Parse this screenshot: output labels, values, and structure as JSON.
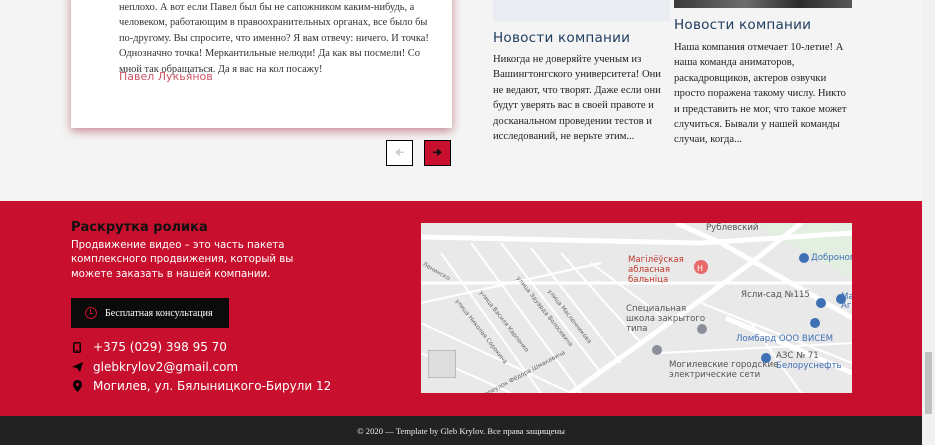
{
  "testimonial": {
    "text": "неплохо. А вот если Павел был бы не сапожником каким-нибудь, а человеком, работающим в правоохранительных органах, все было бы по-другому. Вы спросите, что именно? Я вам отвечу: ничего. И точка! Однозначно точка! Меркантильные нелюди! Да как вы посмели! Со мной так обращаться. Да я вас на кол посажу!",
    "author": "Павел Лукьянов"
  },
  "pager": {
    "prev_icon": "arrow-left-icon",
    "next_icon": "arrow-right-icon"
  },
  "news": [
    {
      "title": "Новости компании",
      "text": "Никогда не доверяйте ученым из Вашингтонгского университета! Они не ведают, что творят. Даже если они будут уверять вас в своей правоте и досканальном проведении тестов и исследований, не верьте этим..."
    },
    {
      "title": "Новости компании",
      "text": "Наша компания отмечает 10-летие! А наша команда аниматоров, раскадровщиков, актеров озвучки просто поражена такому числу. Никто и представить не мог, что такое может случиться. Бывали у нашей команды случаи, когда..."
    }
  ],
  "footer": {
    "title": "Раскрутка ролика",
    "description": "Продвижение видео – это часть пакета комплексного продвижения, который вы можете заказать в нашей компании.",
    "consult_button": "Бесплатная консультация",
    "phone": "+375 (029) 398 95 70",
    "email": "glebkrylov2@gmail.com",
    "address": "Могилев, ул. Бялыницкого-Бирули 12"
  },
  "map": {
    "labels": {
      "hospital": "Магілёўская абласная бальніца",
      "school": "Специальная школа закрытого типа",
      "yasli": "Ясли-сад №115",
      "dobronom": "Доброном",
      "lombard": "Ломбард ООО ВИСЕМ",
      "azs": "АЗС № 71",
      "belorusneft": "Белоруснефть",
      "electro": "Могилевские городские электрические сети",
      "rublevsky": "Рублевский",
      "ma": "Ма Аг",
      "street_fedora": "переулок Фёдора Шмакевича",
      "street_vasily": "улица Василя Карпенко",
      "street_eduard": "улица Эдуарда Волосевича",
      "street_maslennikova": "улица Масленникова",
      "street_nikolai": "улица Николая Сорокина",
      "street_left": "Ленинско"
    }
  },
  "copyright": "© 2020 — Template by Gleb Krylov. Все права защищены",
  "colors": {
    "brand_red": "#c8102e",
    "dark": "#222222",
    "news_title": "#1d3c5e"
  }
}
